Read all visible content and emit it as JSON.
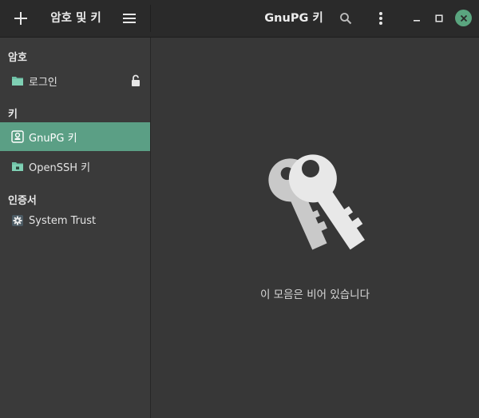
{
  "header": {
    "app_title": "암호 및 키",
    "page_title": "GnuPG 키",
    "add_icon": "plus-icon",
    "menu_icon": "hamburger-menu-icon",
    "search_icon": "search-icon",
    "more_icon": "vertical-ellipsis-icon",
    "window_controls": [
      "minimize-icon",
      "maximize-icon",
      "close-icon"
    ]
  },
  "sidebar": {
    "sections": [
      {
        "title": "암호",
        "items": [
          {
            "label": "로그인",
            "icon": "folder-icon",
            "locked": false,
            "lock_icon": "unlocked-padlock-icon"
          }
        ]
      },
      {
        "title": "키",
        "items": [
          {
            "label": "GnuPG 키",
            "icon": "gnupg-key-icon",
            "selected": true
          },
          {
            "label": "OpenSSH 키",
            "icon": "ssh-folder-icon"
          }
        ]
      },
      {
        "title": "인증서",
        "items": [
          {
            "label": "System Trust",
            "icon": "gear-icon"
          }
        ]
      }
    ]
  },
  "content": {
    "illustration": "keys-icon",
    "empty_message": "이 모음은 비어 있습니다"
  },
  "colors": {
    "accent": "#5b9f85",
    "close_button": "#5aa57f",
    "header_bg": "#2a2a2a",
    "sidebar_bg": "#3a3a3a",
    "content_bg": "#373737"
  }
}
